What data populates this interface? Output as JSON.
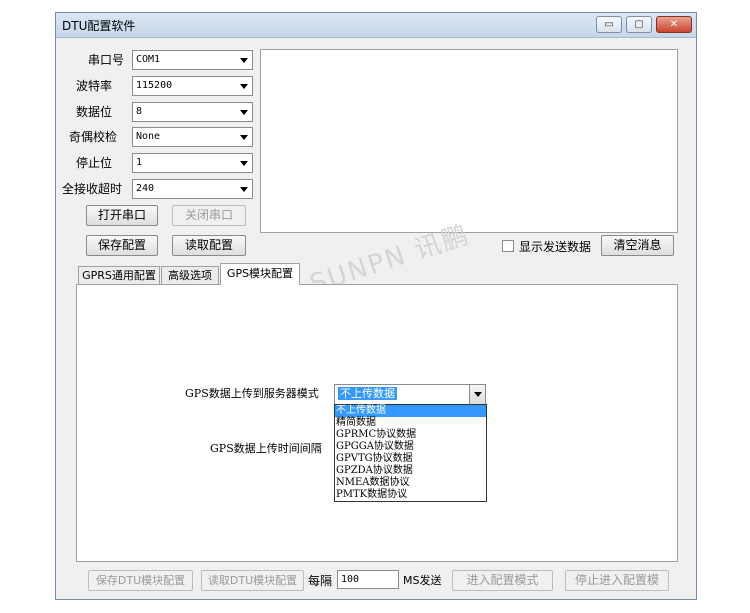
{
  "window": {
    "title": "DTU配置软件",
    "buttons": {
      "minimize": "▭",
      "maximize": "▢",
      "close": "✕"
    }
  },
  "serial": {
    "port_label": "串口号",
    "port_value": "COM1",
    "baud_label": "波特率",
    "baud_value": "115200",
    "databits_label": "数据位",
    "databits_value": "8",
    "parity_label": "奇偶校检",
    "parity_value": "None",
    "stopbits_label": "停止位",
    "stopbits_value": "1",
    "timeout_label": "全接收超时",
    "timeout_value": "240"
  },
  "buttons": {
    "open_port": "打开串口",
    "close_port": "关闭串口",
    "save_config": "保存配置",
    "read_config": "读取配置",
    "clear_msg": "清空消息"
  },
  "show_send": {
    "label": "显示发送数据",
    "checked": false
  },
  "watermark": "SUNPN 讯鹏",
  "tabs": [
    {
      "label": "GPRS通用配置"
    },
    {
      "label": "高级选项"
    },
    {
      "label": "GPS模块配置"
    }
  ],
  "gps": {
    "mode_label": "GPS数据上传到服务器模式",
    "mode_value": "不上传数据",
    "interval_label": "GPS数据上传时间间隔",
    "options": [
      "不上传数据",
      "精简数据",
      "GPRMC协议数据",
      "GPGGA协议数据",
      "GPVTG协议数据",
      "GPZDA协议数据",
      "NMEA数据协议",
      "PMTK数据协议"
    ]
  },
  "bottom": {
    "save_dtu": "保存DTU模块配置",
    "read_dtu": "读取DTU模块配置",
    "every_label": "每隔",
    "every_value": "100",
    "ms_label": "MS发送",
    "enter_config": "进入配置模式",
    "stop_config": "停止进入配置模"
  },
  "colors": {
    "accent": "#3399ff",
    "close_btn": "#c9452e",
    "disabled_text": "#9a9a9a"
  }
}
